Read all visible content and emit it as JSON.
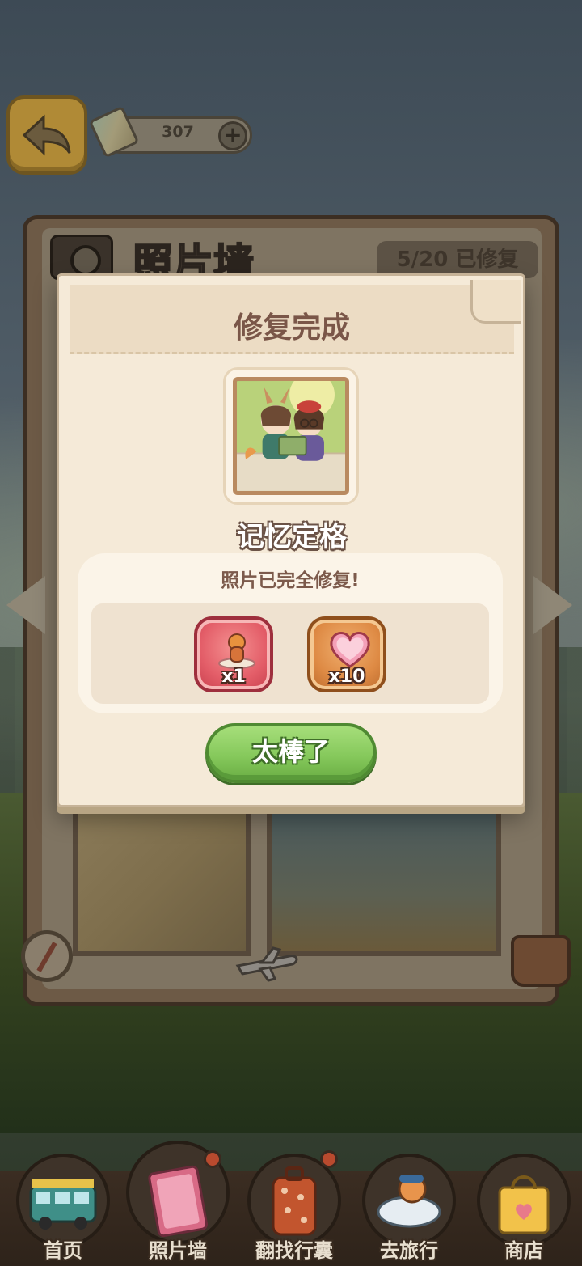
{
  "top_bar": {
    "currency_value": "307"
  },
  "wall": {
    "title": "照片墙",
    "repair_count": "5/20 已修复"
  },
  "modal": {
    "title": "修复完成",
    "photo_name": "记忆定格",
    "caption": "照片已完全修复!",
    "rewards": [
      {
        "icon": "figurine-reward-icon",
        "qty": "x1",
        "color": "#e35d68"
      },
      {
        "icon": "heart-reward-icon",
        "qty": "x10",
        "color": "#de8a44"
      }
    ],
    "confirm_label": "太棒了"
  },
  "nav": {
    "items": [
      {
        "label": "首页",
        "icon": "bus-icon",
        "badge": false
      },
      {
        "label": "照片墙",
        "icon": "photo-album-icon",
        "badge": true,
        "active": true
      },
      {
        "label": "翻找行囊",
        "icon": "suitcase-icon",
        "badge": true
      },
      {
        "label": "去旅行",
        "icon": "pilot-icon",
        "badge": false
      },
      {
        "label": "商店",
        "icon": "shopping-bag-icon",
        "badge": false
      }
    ]
  },
  "colors": {
    "accent_green": "#86c95c",
    "title_brown": "#7a5648",
    "panel_cream": "#f5ead8"
  }
}
